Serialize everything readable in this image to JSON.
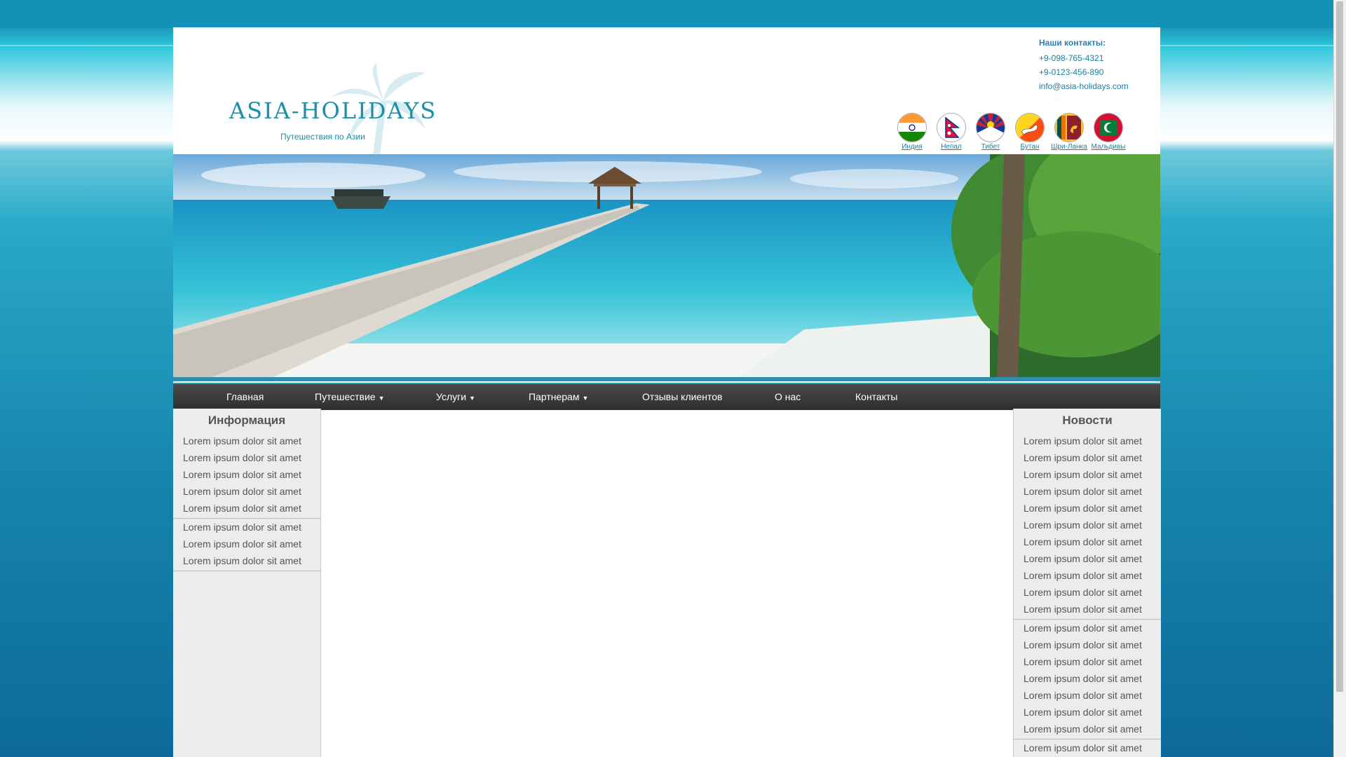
{
  "logo": {
    "text": "ASIA-HOLIDAYS",
    "subtitle": "Путешествия по Азии"
  },
  "contacts": {
    "title": "Наши контакты:",
    "phone1": "+9-098-765-4321",
    "phone2": "+9-0123-456-890",
    "email": "info@asia-holidays.com"
  },
  "flags": [
    {
      "label": "Индия",
      "icon": "india-flag-icon"
    },
    {
      "label": "Непал",
      "icon": "nepal-flag-icon"
    },
    {
      "label": "Тибет",
      "icon": "tibet-flag-icon"
    },
    {
      "label": "Бутан",
      "icon": "bhutan-flag-icon"
    },
    {
      "label": "Шри-Ланка",
      "icon": "sri-lanka-flag-icon"
    },
    {
      "label": "Мальдивы",
      "icon": "maldives-flag-icon"
    }
  ],
  "nav": {
    "items": [
      {
        "label": "Главная",
        "arrow": ""
      },
      {
        "label": "Путешествие",
        "arrow": "▼"
      },
      {
        "label": "Услуги",
        "arrow": "▼"
      },
      {
        "label": "Партнерам",
        "arrow": "▼"
      },
      {
        "label": "Отзывы клиентов",
        "arrow": ""
      },
      {
        "label": "О нас",
        "arrow": ""
      },
      {
        "label": "Контакты",
        "arrow": ""
      }
    ]
  },
  "left": {
    "title": "Информация",
    "groups": [
      [
        "Lorem ipsum dolor sit amet",
        "Lorem ipsum dolor sit amet",
        "Lorem ipsum dolor sit amet",
        "Lorem ipsum dolor sit amet",
        "Lorem ipsum dolor sit amet"
      ],
      [
        "Lorem ipsum dolor sit amet",
        "Lorem ipsum dolor sit amet",
        "Lorem ipsum dolor sit amet"
      ]
    ]
  },
  "right": {
    "title": "Новости",
    "groups": [
      [
        "Lorem ipsum dolor sit amet",
        "Lorem ipsum dolor sit amet",
        "Lorem ipsum dolor sit amet",
        "Lorem ipsum dolor sit amet",
        "Lorem ipsum dolor sit amet",
        "Lorem ipsum dolor sit amet",
        "Lorem ipsum dolor sit amet",
        "Lorem ipsum dolor sit amet",
        "Lorem ipsum dolor sit amet",
        "Lorem ipsum dolor sit amet",
        "Lorem ipsum dolor sit amet"
      ],
      [
        "Lorem ipsum dolor sit amet",
        "Lorem ipsum dolor sit amet",
        "Lorem ipsum dolor sit amet",
        "Lorem ipsum dolor sit amet",
        "Lorem ipsum dolor sit amet",
        "Lorem ipsum dolor sit amet",
        "Lorem ipsum dolor sit amet"
      ],
      [
        "Lorem ipsum dolor sit amet"
      ]
    ]
  },
  "colors": {
    "accent": "#1a8fa6",
    "nav_bg": "#3a3a3a",
    "sidebar_bg": "#ececec"
  }
}
